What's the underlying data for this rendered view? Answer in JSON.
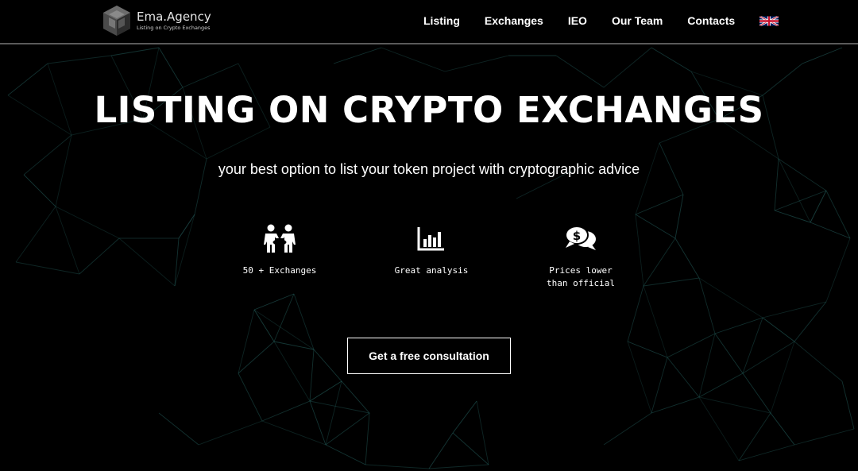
{
  "brand": {
    "name": "Ema.Agency",
    "tagline": "Listing on Crypto Exchanges",
    "logo_icon": "cube-logo-icon"
  },
  "nav": {
    "items": [
      {
        "label": "Listing"
      },
      {
        "label": "Exchanges"
      },
      {
        "label": "IEO"
      },
      {
        "label": "Our Team"
      },
      {
        "label": "Contacts"
      }
    ],
    "language_icon": "uk-flag-icon"
  },
  "hero": {
    "title": "LISTING ON CRYPTO EXCHANGES",
    "subtitle": "your best option to list your token project with cryptographic advice"
  },
  "features": [
    {
      "icon": "handshake-exchange-icon",
      "label": "50 + Exchanges"
    },
    {
      "icon": "bar-chart-icon",
      "label": "Great analysis"
    },
    {
      "icon": "money-chat-icon",
      "label": "Prices lower\nthan official"
    }
  ],
  "cta": {
    "label": "Get a free consultation"
  },
  "colors": {
    "background": "#000000",
    "text": "#ffffff",
    "network_lines": "#2a6f6c",
    "header_border": "#5a5a5a"
  }
}
